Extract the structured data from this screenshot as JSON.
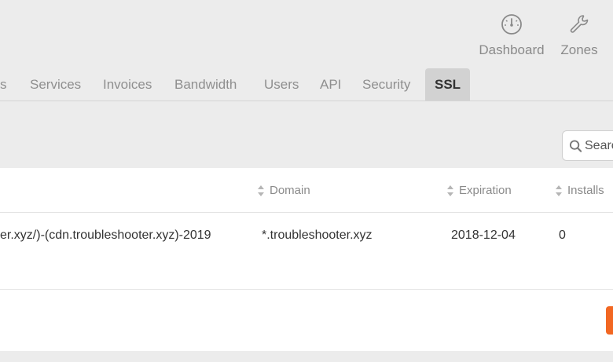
{
  "topnav": {
    "dashboard_label": "Dashboard",
    "zones_label": "Zones"
  },
  "tabs": [
    {
      "label": "s"
    },
    {
      "label": "Services"
    },
    {
      "label": "Invoices"
    },
    {
      "label": "Bandwidth"
    },
    {
      "label": "Users"
    },
    {
      "label": "API"
    },
    {
      "label": "Security"
    },
    {
      "label": "SSL"
    }
  ],
  "search": {
    "placeholder": "Search"
  },
  "table": {
    "columns": {
      "domain": "Domain",
      "expiration": "Expiration",
      "installs": "Installs"
    },
    "rows": [
      {
        "name": "er.xyz/)-(cdn.troubleshooter.xyz)-2019",
        "domain": "*.troubleshooter.xyz",
        "expiration": "2018-12-04",
        "installs": "0"
      }
    ]
  },
  "colors": {
    "accent": "#f26722",
    "active_tab_bg": "#d2d2d2",
    "page_bg": "#ececec"
  }
}
